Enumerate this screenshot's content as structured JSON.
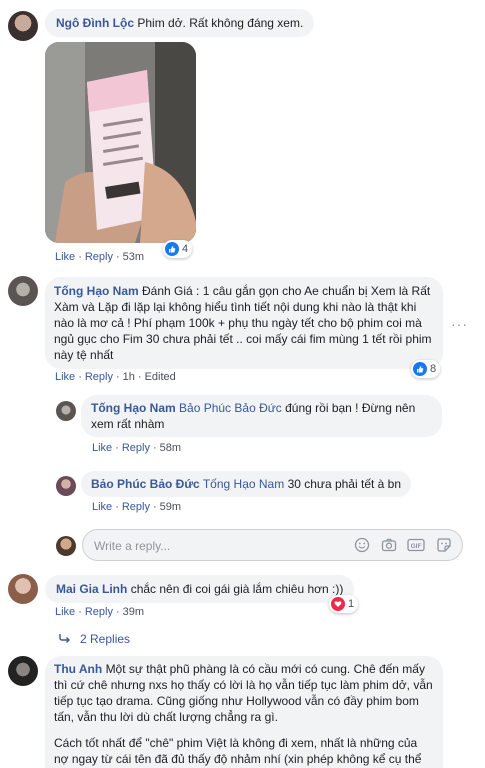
{
  "comments": [
    {
      "name": "Ngô Đình Lộc",
      "text": "Phim dở. Rất không đáng xem.",
      "like": "Like",
      "reply": "Reply",
      "time": "53m",
      "reactions": "4"
    },
    {
      "name": "Tống Hạo Nam",
      "text": "Đánh Giá : 1 câu gắn gọn cho Ae chuẩn bị Xem là Rất Xàm và Lặp đi lặp lại không hiểu tình tiết nội dung khi nào là thật khi nào là mơ cả ! Phí phạm 100k + phụ thu ngày tết cho bộ phim coi mà ngủ gục cho Fim 30 chưa phải tết .. coi mấy cái fim mùng 1 tết rồi phim này tệ nhất",
      "like": "Like",
      "reply": "Reply",
      "time": "1h",
      "edited": "Edited",
      "reactions": "8"
    },
    {
      "name": "Mai Gia Linh",
      "text": "chắc nên đi coi gái già lắm chiêu hơn :))",
      "like": "Like",
      "reply": "Reply",
      "time": "39m",
      "reactions": "1",
      "replies_link": "2 Replies"
    },
    {
      "name": "Thu Anh",
      "p1": "Một sự thật phũ phàng là có cầu mới có cung. Chê đến mấy thì cứ chê nhưng nxs họ thấy có lời là họ vẫn tiếp tục làm phim dở, vẫn tiếp tục tạo drama. Cũng giống như Hollywood vẫn có đầy phim bom tấn, vẫn thu lời dù chất lượng chẳng ra gì.",
      "p2": "Cách tốt nhất để \"chê\" phim Việt là không đi xem, nhất là những của nợ ngay từ cái tên đã đủ thấy độ nhảm nhí (xin phép không kể cụ thể không bị kêu là tẩy chay nhưng mọi người tự hiểu)"
    }
  ],
  "replies": [
    {
      "name": "Tống Hạo Nam",
      "tag": "Bảo Phúc Bảo Đức",
      "text": "đúng rồi bạn ! Đừng nên xem rất nhàm",
      "like": "Like",
      "reply": "Reply",
      "time": "58m"
    },
    {
      "name": "Bảo Phúc Bảo Đức",
      "tag": "Tống Hạo Nam",
      "text": "30 chưa phải tết à bn",
      "like": "Like",
      "reply": "Reply",
      "time": "59m"
    }
  ],
  "composer": {
    "placeholder": "Write a reply..."
  },
  "icons": [
    "like-icon",
    "heart-icon",
    "emoji-icon",
    "camera-icon",
    "gif-icon",
    "sticker-icon",
    "reply-arrow-icon",
    "more-options-icon"
  ],
  "colors": {
    "link": "#385898",
    "bubble": "#f2f3f5",
    "like_blue": "#1877f2",
    "heart_red": "#f0284a"
  }
}
